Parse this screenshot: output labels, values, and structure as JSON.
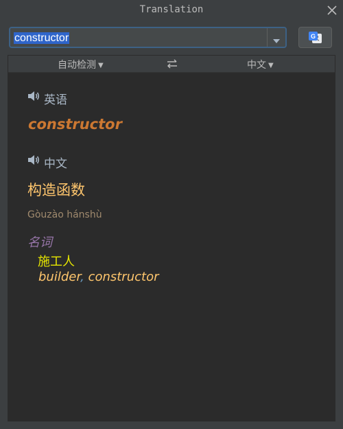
{
  "window": {
    "title": "Translation",
    "close_icon": "close-icon"
  },
  "input": {
    "value": "constructor",
    "dropdown_icon": "chevron-down-icon"
  },
  "translate_button": {
    "icon": "google-translate-icon"
  },
  "langbar": {
    "source": "自动检测",
    "target": "中文",
    "swap_icon": "swap-arrows-icon"
  },
  "source": {
    "language": "英语",
    "word": "constructor",
    "speaker_icon": "speaker-icon"
  },
  "target": {
    "language": "中文",
    "translation": "构造函数",
    "pinyin": "Gòuzào hánshù",
    "speaker_icon": "speaker-icon"
  },
  "dictionary": {
    "part_of_speech": "名词",
    "entries": [
      {
        "word": "施工人",
        "synonyms": [
          "builder",
          "constructor"
        ]
      }
    ]
  },
  "colors": {
    "background": "#3c3f41",
    "panel": "#2b2b2b",
    "source_word": "#cc7832",
    "translation": "#ffc66d",
    "pinyin": "#a08a6e",
    "part_of_speech": "#9876aa",
    "meaning": "#e8e800",
    "separator": "#6897bb",
    "selection": "#2f65ca"
  }
}
